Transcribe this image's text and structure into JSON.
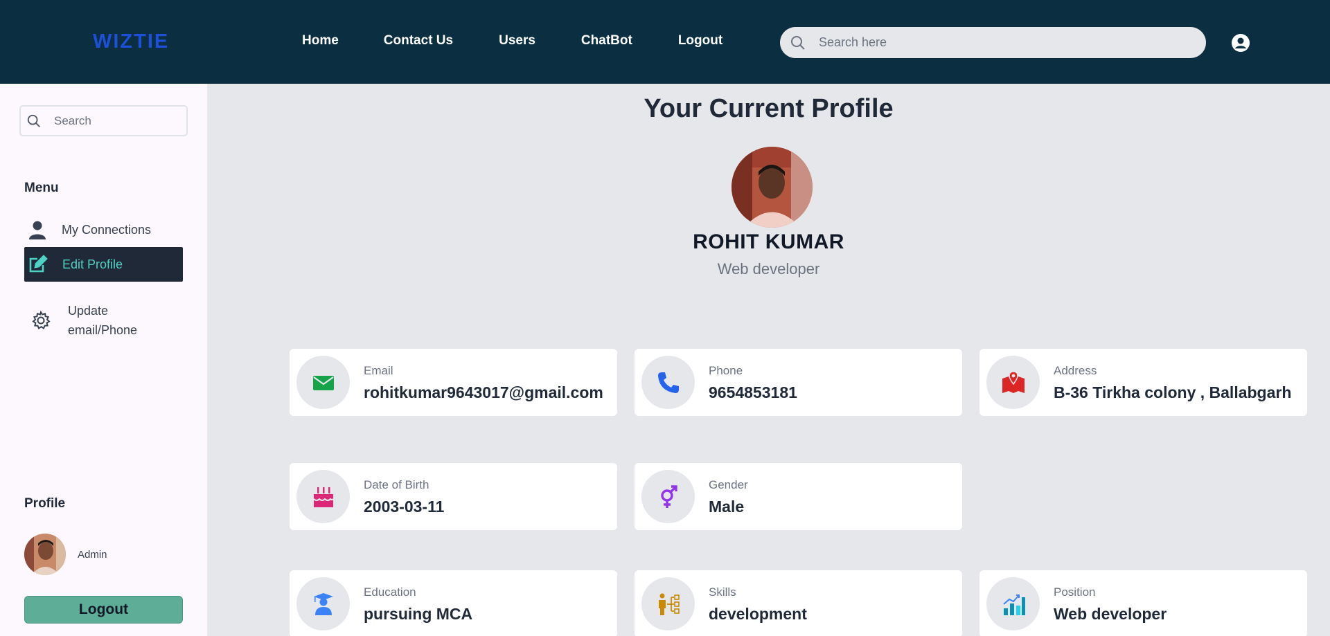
{
  "brand": "WIZTIE",
  "nav": {
    "home": "Home",
    "contact": "Contact Us",
    "users": "Users",
    "chatbot": "ChatBot",
    "logout": "Logout"
  },
  "top_search": {
    "placeholder": "Search here"
  },
  "sidebar": {
    "search_placeholder": "Search",
    "menu_heading": "Menu",
    "items": [
      {
        "label": "My Connections",
        "icon": "user-icon"
      },
      {
        "label": "Edit Profile",
        "icon": "edit-icon",
        "active": true
      },
      {
        "label": "Update email/Phone",
        "icon": "gear-icon"
      }
    ],
    "profile_heading": "Profile",
    "profile_role": "Admin",
    "logout_label": "Logout"
  },
  "main": {
    "title": "Your Current Profile",
    "name": "ROHIT KUMAR",
    "role": "Web developer",
    "fields": [
      {
        "label": "Email",
        "value": "rohitkumar9643017@gmail.com",
        "icon": "envelope-icon",
        "color": "#16a34a"
      },
      {
        "label": "Phone",
        "value": "9654853181",
        "icon": "phone-icon",
        "color": "#2563eb"
      },
      {
        "label": "Address",
        "value": "B-36 Tirkha colony , Ballabgarh",
        "icon": "map-icon",
        "color": "#dc2626"
      },
      {
        "label": "Date of Birth",
        "value": "2003-03-11",
        "icon": "cake-icon",
        "color": "#db2777"
      },
      {
        "label": "Gender",
        "value": "Male",
        "icon": "gender-icon",
        "color": "#9333ea"
      },
      {
        "label": "Education",
        "value": "pursuing MCA",
        "icon": "graduate-icon",
        "color": "#3b82f6"
      },
      {
        "label": "Skills",
        "value": "development",
        "icon": "skills-icon",
        "color": "#ca8a04"
      },
      {
        "label": "Position",
        "value": "Web developer",
        "icon": "chart-icon",
        "color": "#0891b2"
      }
    ]
  },
  "colors": {
    "navbar": "#0b2f40",
    "brand": "#1e4fd8",
    "active_menu_bg": "#1f2937",
    "active_menu_text": "#4fd1c5",
    "logout_button": "#5eae97"
  }
}
